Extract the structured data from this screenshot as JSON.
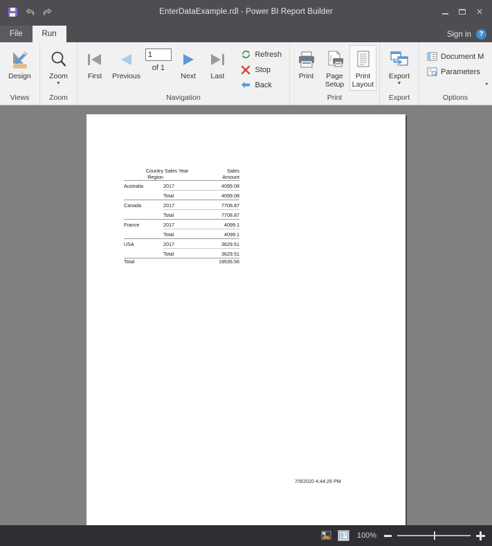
{
  "titlebar": {
    "title": "EnterDataExample.rdl - Power BI Report Builder",
    "quick_access": [
      {
        "name": "save-icon",
        "label": "Save"
      },
      {
        "name": "undo-icon",
        "label": "↰"
      },
      {
        "name": "redo-icon",
        "label": "↱"
      }
    ],
    "minimize": "",
    "maximize": "",
    "close": "✕"
  },
  "tabs": {
    "file": "File",
    "run": "Run",
    "signin": "Sign in",
    "help": "?"
  },
  "ribbon": {
    "groups": [
      {
        "label": "Views"
      },
      {
        "label": "Zoom"
      },
      {
        "label": "Navigation"
      },
      {
        "label": "Print"
      },
      {
        "label": "Export"
      },
      {
        "label": "Options"
      }
    ],
    "views": {
      "design": "Design"
    },
    "zoom": {
      "zoom": "Zoom"
    },
    "navigation": {
      "first": "First",
      "previous": "Previous",
      "next": "Next",
      "last": "Last",
      "page_value": "1",
      "of_label": "of  1",
      "refresh": "Refresh",
      "stop": "Stop",
      "back": "Back"
    },
    "print": {
      "print": "Print",
      "page_setup": "Page\nSetup",
      "page_setup_l1": "Page",
      "page_setup_l2": "Setup",
      "print_layout_l1": "Print",
      "print_layout_l2": "Layout"
    },
    "export": {
      "export": "Export"
    },
    "options": {
      "document_map": "Document M",
      "parameters": "Parameters",
      "expand": "▸"
    }
  },
  "report": {
    "table": {
      "headers": {
        "col1_line1": "Country",
        "col1_line2": "Region",
        "col2": "Sales Year",
        "col3_line1": "Sales",
        "col3_line2": "Amount"
      },
      "groups": [
        {
          "region": "Australia",
          "year": "2017",
          "amount": "4099.08",
          "total_label": "Total",
          "total_amount": "4099.08"
        },
        {
          "region": "Canada",
          "year": "2017",
          "amount": "7708.87",
          "total_label": "Total",
          "total_amount": "7708.87"
        },
        {
          "region": "France",
          "year": "2017",
          "amount": "4099.1",
          "total_label": "Total",
          "total_amount": "4099.1"
        },
        {
          "region": "USA",
          "year": "2017",
          "amount": "3629.51",
          "total_label": "Total",
          "total_amount": "3629.51"
        }
      ],
      "grand_total_label": "Total",
      "grand_total_amount": "19536.56"
    },
    "timestamp": "7/9/2020 4:44:26 PM"
  },
  "statusbar": {
    "zoom_level": "100%",
    "zoom_minus": "−",
    "zoom_plus": "+"
  },
  "colors": {
    "titlebar": "#4d4d52",
    "ribbon": "#f1f1f1",
    "canvas": "#808080",
    "statusbar": "#2f2f33",
    "accent_save": "#8a5fd6",
    "accent_help": "#3d8fd4",
    "refresh_green": "#3f9c4f",
    "stop_red": "#d14b3e",
    "back_blue": "#5b9bd5",
    "nav_blue": "#5b9bd5",
    "nav_gray": "#9a9a9a"
  }
}
